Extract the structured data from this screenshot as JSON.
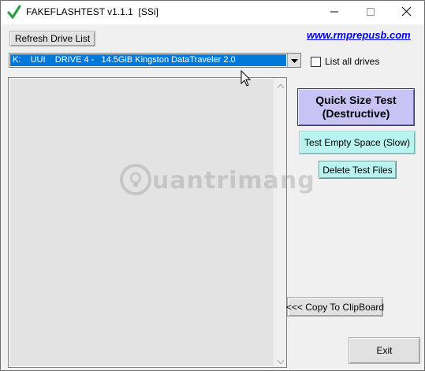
{
  "window": {
    "title": "FAKEFLASHTEST v1.1.1  [SSi]",
    "icon": "green-check-icon",
    "controls": [
      "minimize-icon",
      "maximize-icon",
      "close-icon"
    ]
  },
  "toolbar": {
    "refresh_label": "Refresh Drive List",
    "link_text": "www.rmprepusb.com"
  },
  "drive_select": {
    "selected": "K:    UUI    DRIVE 4 -   14.5GiB Kingston DataTraveler 2.0"
  },
  "options": {
    "list_all_drives_label": "List all drives",
    "list_all_drives_checked": false
  },
  "actions": {
    "quick_test_label": "Quick Size Test (Destructive)",
    "empty_space_label": "Test Empty Space (Slow)",
    "delete_files_label": "Delete Test Files",
    "clipboard_label": "<<< Copy To ClipBoard",
    "exit_label": "Exit"
  },
  "watermark": {
    "text": "uantrimang"
  },
  "colors": {
    "quick_test_bg": "#c7c3f5",
    "cyan_button_bg": "#b8f3f0",
    "selection_bg": "#0078d7",
    "link": "#0000ee",
    "title_check": "#2ea043"
  }
}
